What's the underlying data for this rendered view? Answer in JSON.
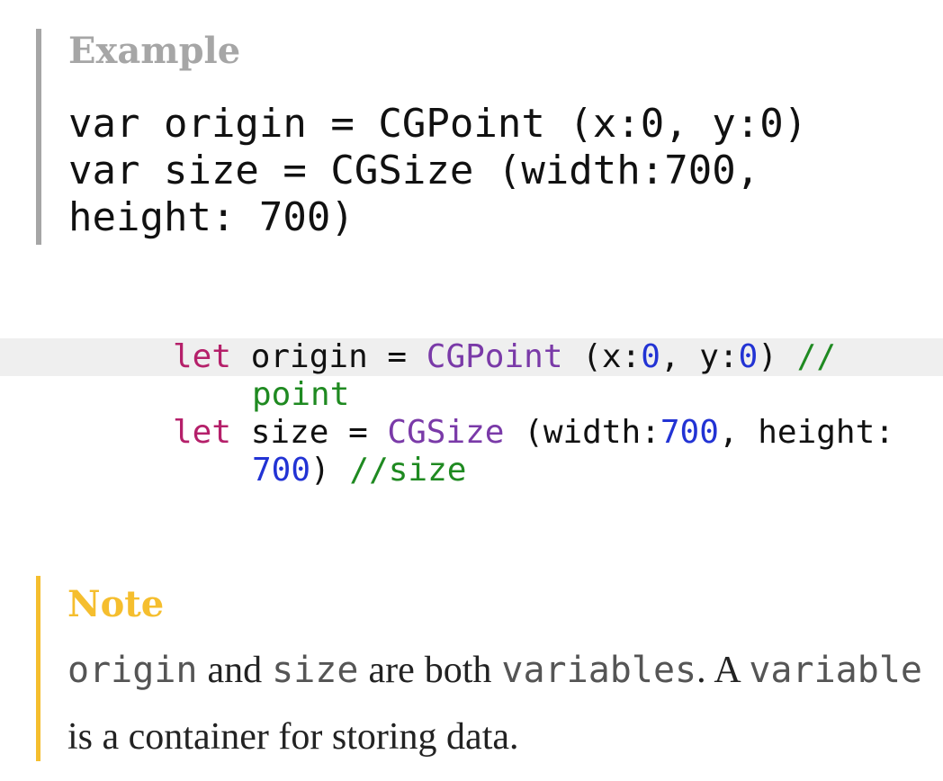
{
  "example": {
    "title": "Example",
    "lines": [
      "var origin = CGPoint (x:0, y:0)",
      "var size = CGSize (width:700,",
      "height: 700)"
    ]
  },
  "code": {
    "line1": {
      "kw": "let",
      "name": " origin = ",
      "type": "CGPoint",
      "args_open": " (x:",
      "num1": "0",
      "sep": ", y:",
      "num2": "0",
      "close": ") ",
      "comment": "//"
    },
    "line2": {
      "comment": "point"
    },
    "line3": {
      "kw": "let",
      "name": " size = ",
      "type": "CGSize",
      "args_open": " (width:",
      "num1": "700",
      "sep": ", height:"
    },
    "line4": {
      "num": "700",
      "close": ") ",
      "comment": "//size"
    }
  },
  "note": {
    "title": "Note",
    "code1": "origin",
    "text1": " and ",
    "code2": "size",
    "text2": " are both ",
    "code3": "variables",
    "text3": ". A ",
    "code4": "variable",
    "text4": " is a container for storing data."
  },
  "colors": {
    "example_accent": "#a6a6a6",
    "note_accent": "#f5be2e",
    "keyword": "#b5206a",
    "type": "#7a3aa8",
    "number": "#2233d4",
    "comment": "#1f8a21",
    "highlight_row": "#efefef"
  }
}
